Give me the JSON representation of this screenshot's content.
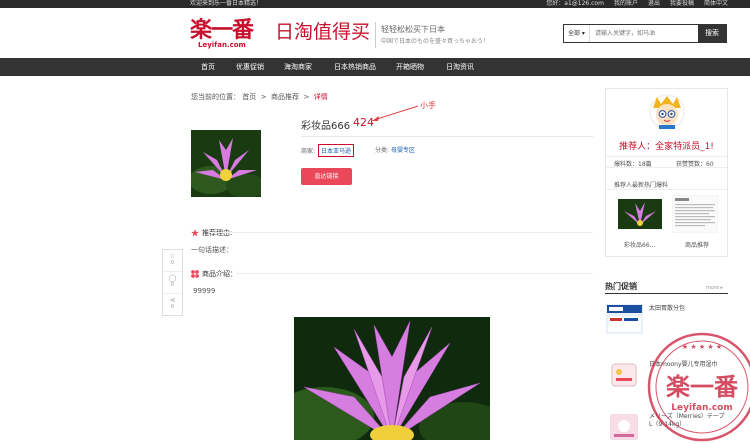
{
  "topbar": {
    "welcome": "欢迎来到乐一番日本精选！",
    "user": "您好：a1@126.com",
    "links": [
      "我的账户",
      "退出",
      "我要投稿",
      "简体中文"
    ]
  },
  "header": {
    "logo_cn": "楽一番",
    "logo_en": "Leyifan.com",
    "slogan": "日淘值得买",
    "sub1": "轻轻松松买下日本",
    "sub2": "中国で日本のものを盛々買っちゃおう！"
  },
  "search": {
    "select": "全部",
    "placeholder": "请输入关键字，如马油",
    "button": "搜索"
  },
  "nav": [
    "首页",
    "优惠促销",
    "海淘商家",
    "日本热销商品",
    "开箱晒物",
    "日淘资讯"
  ],
  "breadcrumb": {
    "prefix": "您当前的位置：",
    "home": "首页",
    "sep": ">",
    "mid": "商品推荐",
    "cur": "详情"
  },
  "product": {
    "title": "彩妆品666",
    "price": "424",
    "merchant_label": "商家:",
    "merchant": "日本亚马逊",
    "category_label": "分类:",
    "category": "母婴专区",
    "buy_button": "直达链接"
  },
  "annotation": "小手",
  "sections": {
    "reason_title": "推荐理由:",
    "reason_text": "一句话描述：",
    "intro_title": "商品介绍：",
    "intro_text": "99999"
  },
  "float_bar": {
    "fav_count": "0",
    "comment_count": "0",
    "share_count": "0"
  },
  "recommender": {
    "name": "推荐人：全家特派员_1!",
    "posts_label": "爆料数：18篇",
    "likes_label": "获赞赞数：60",
    "latest_title": "推荐人最新热门爆料",
    "caption1": "彩妆品66...",
    "caption2": "商品推荐"
  },
  "hot": {
    "title": "热门促销",
    "more": "more ▸",
    "items": [
      "太田胃散分包",
      "日本moony婴儿专用湿巾",
      "メリーズ（Merries）テープ L（9-14kg）"
    ]
  },
  "stamp": {
    "logo": "楽一番",
    "url": "Leyifan.com"
  }
}
